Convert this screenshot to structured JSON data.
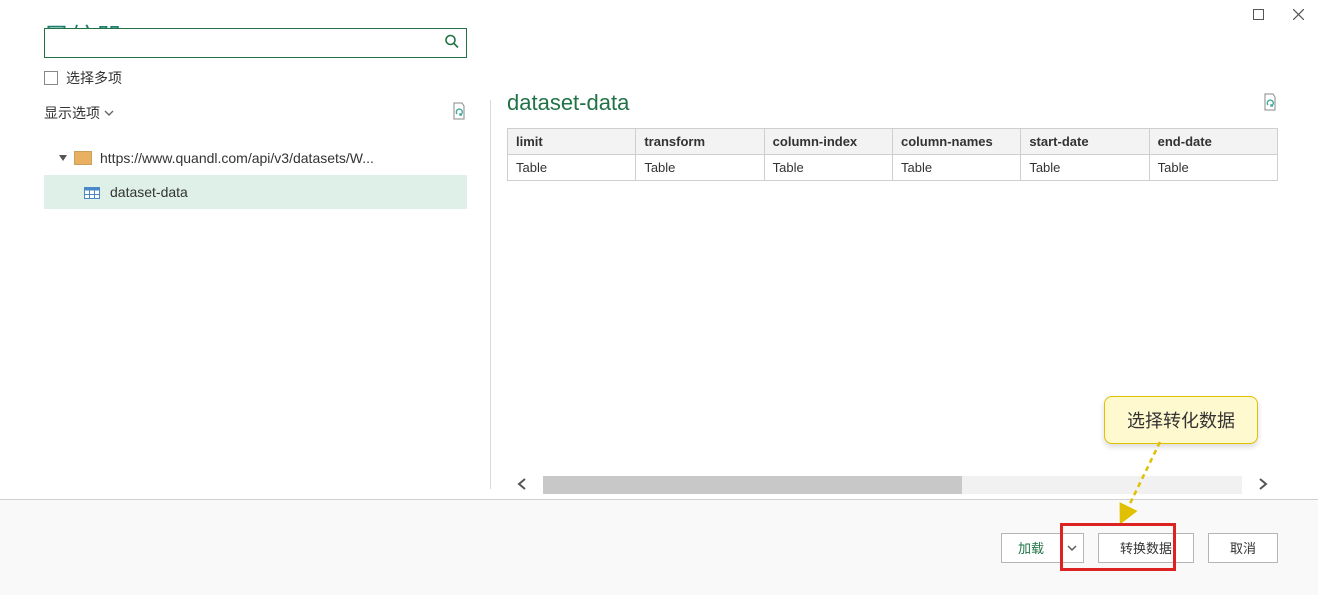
{
  "window": {
    "title": "导航器"
  },
  "search": {
    "placeholder": ""
  },
  "checkbox": {
    "multi_select": "选择多项"
  },
  "display_options": "显示选项",
  "tree": {
    "root": {
      "label": "https://www.quandl.com/api/v3/datasets/W..."
    },
    "items": [
      {
        "label": "dataset-data"
      }
    ]
  },
  "preview": {
    "title": "dataset-data",
    "columns": [
      "limit",
      "transform",
      "column-index",
      "column-names",
      "start-date",
      "end-date"
    ],
    "rows": [
      [
        "Table",
        "Table",
        "Table",
        "Table",
        "Table",
        "Table"
      ]
    ]
  },
  "buttons": {
    "load": "加载",
    "transform": "转换数据",
    "cancel": "取消"
  },
  "annotation": {
    "callout": "选择转化数据"
  }
}
